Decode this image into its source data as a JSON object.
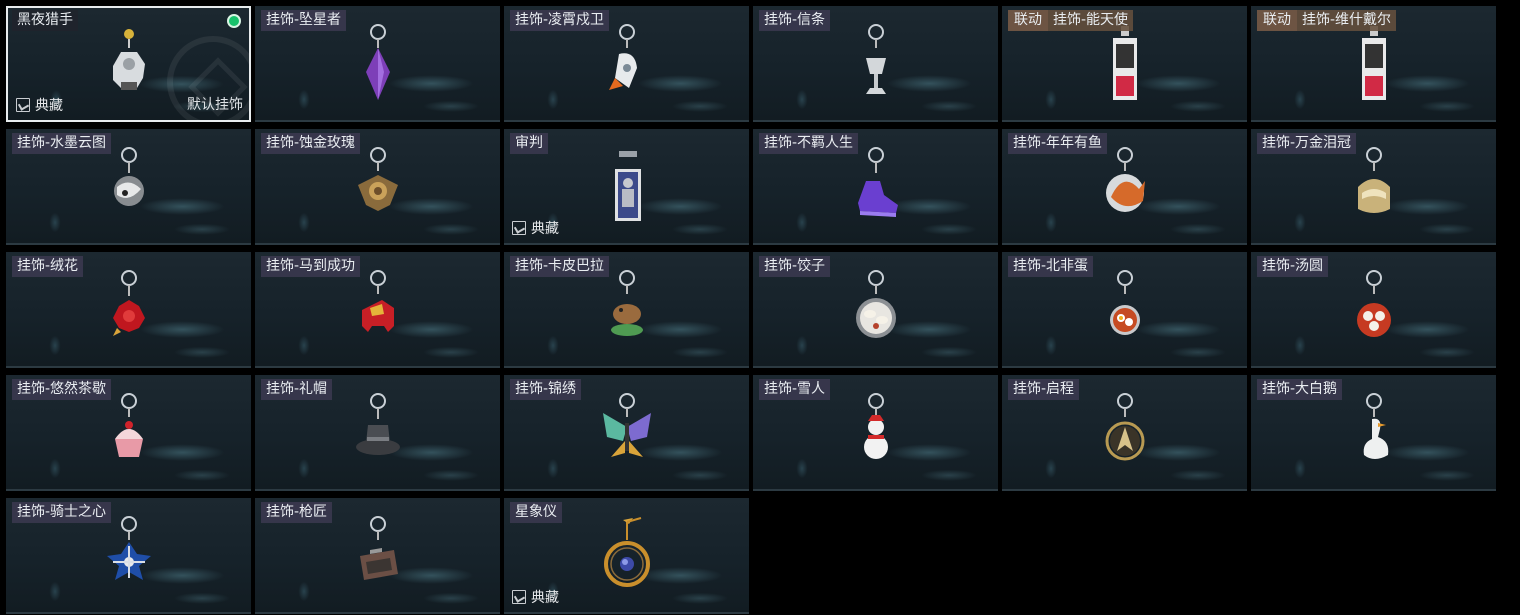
{
  "badges": {
    "collection": "典藏",
    "default": "默认挂饰"
  },
  "colors": {
    "equipped": "#17c26b",
    "collab_tag": "#6d5443"
  },
  "items": [
    {
      "name": "黑夜猎手",
      "icon": "hunter-figure-icon",
      "selected": true,
      "equipped": true,
      "collection": true,
      "default": true
    },
    {
      "name": "挂饰-坠星者",
      "icon": "purple-crystal-icon"
    },
    {
      "name": "挂饰-凌霄戍卫",
      "icon": "rocket-icon"
    },
    {
      "name": "挂饰-信条",
      "icon": "chalice-icon"
    },
    {
      "name": "挂饰-能天使",
      "icon": "collab-card-icon",
      "collab": "联动"
    },
    {
      "name": "挂饰-维什戴尔",
      "icon": "collab-card-icon",
      "collab": "联动"
    },
    {
      "name": "挂饰-水墨云图",
      "icon": "ink-sphere-icon"
    },
    {
      "name": "挂饰-蚀金玫瑰",
      "icon": "gold-rose-icon"
    },
    {
      "name": "审判",
      "icon": "judgment-card-icon",
      "collection": true
    },
    {
      "name": "挂饰-不羁人生",
      "icon": "sneaker-icon"
    },
    {
      "name": "挂饰-年年有鱼",
      "icon": "fish-plate-icon"
    },
    {
      "name": "挂饰-万金泪冠",
      "icon": "gold-crown-icon"
    },
    {
      "name": "挂饰-绒花",
      "icon": "red-flower-icon"
    },
    {
      "name": "挂饰-马到成功",
      "icon": "red-horse-icon"
    },
    {
      "name": "挂饰-卡皮巴拉",
      "icon": "capybara-icon"
    },
    {
      "name": "挂饰-饺子",
      "icon": "dumpling-plate-icon"
    },
    {
      "name": "挂饰-北非蛋",
      "icon": "egg-pan-icon"
    },
    {
      "name": "挂饰-汤圆",
      "icon": "tangyuan-bowl-icon"
    },
    {
      "name": "挂饰-悠然茶歇",
      "icon": "cupcake-icon"
    },
    {
      "name": "挂饰-礼帽",
      "icon": "top-hat-icon"
    },
    {
      "name": "挂饰-锦绣",
      "icon": "butterfly-icon"
    },
    {
      "name": "挂饰-雪人",
      "icon": "snowman-icon"
    },
    {
      "name": "挂饰-启程",
      "icon": "compass-medal-icon"
    },
    {
      "name": "挂饰-大白鹅",
      "icon": "white-goose-icon"
    },
    {
      "name": "挂饰-骑士之心",
      "icon": "blue-cross-icon"
    },
    {
      "name": "挂饰-枪匠",
      "icon": "toolbox-icon"
    },
    {
      "name": "星象仪",
      "icon": "orrery-icon",
      "collection": true
    }
  ]
}
